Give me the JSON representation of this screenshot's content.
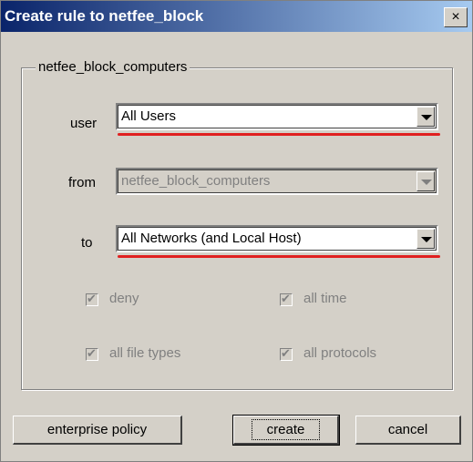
{
  "window": {
    "title": "Create rule to netfee_block",
    "close_symbol": "×"
  },
  "group": {
    "label": "netfee_block_computers"
  },
  "fields": {
    "user": {
      "label": "user",
      "value": "All Users"
    },
    "from": {
      "label": "from",
      "value": "netfee_block_computers"
    },
    "to": {
      "label": "to",
      "value": "All Networks (and Local Host)"
    }
  },
  "options": {
    "deny": "deny",
    "all_time": "all time",
    "all_file_types": "all file types",
    "all_protocols": "all protocols"
  },
  "buttons": {
    "enterprise": "enterprise policy",
    "create": "create",
    "cancel": "cancel"
  }
}
